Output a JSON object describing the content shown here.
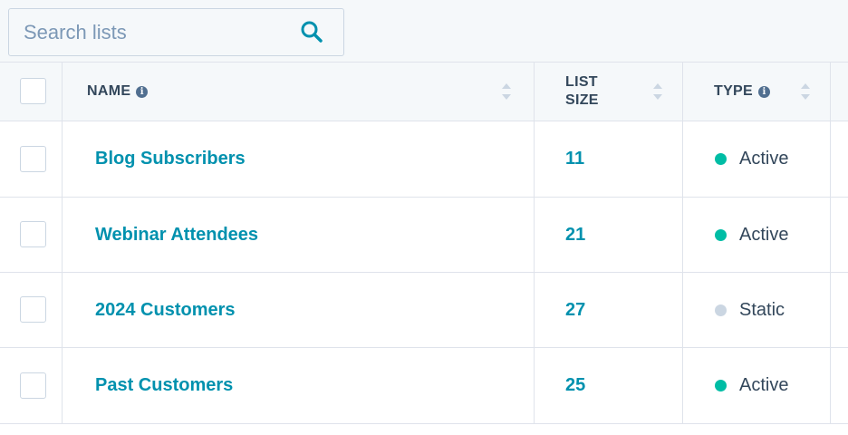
{
  "search": {
    "placeholder": "Search lists",
    "icon": "search-icon"
  },
  "table": {
    "columns": {
      "name": "NAME",
      "size_line1": "LIST",
      "size_line2": "SIZE",
      "type": "TYPE"
    },
    "rows": [
      {
        "name": "Blog Subscribers",
        "size": "11",
        "type": "Active",
        "type_color": "#00bda5"
      },
      {
        "name": "Webinar Attendees",
        "size": "21",
        "type": "Active",
        "type_color": "#00bda5"
      },
      {
        "name": "2024 Customers",
        "size": "27",
        "type": "Static",
        "type_color": "#cbd6e2"
      },
      {
        "name": "Past Customers",
        "size": "25",
        "type": "Active",
        "type_color": "#00bda5"
      }
    ]
  },
  "colors": {
    "link": "#0091ae",
    "active": "#00bda5",
    "static": "#cbd6e2",
    "border": "#dfe3eb"
  }
}
